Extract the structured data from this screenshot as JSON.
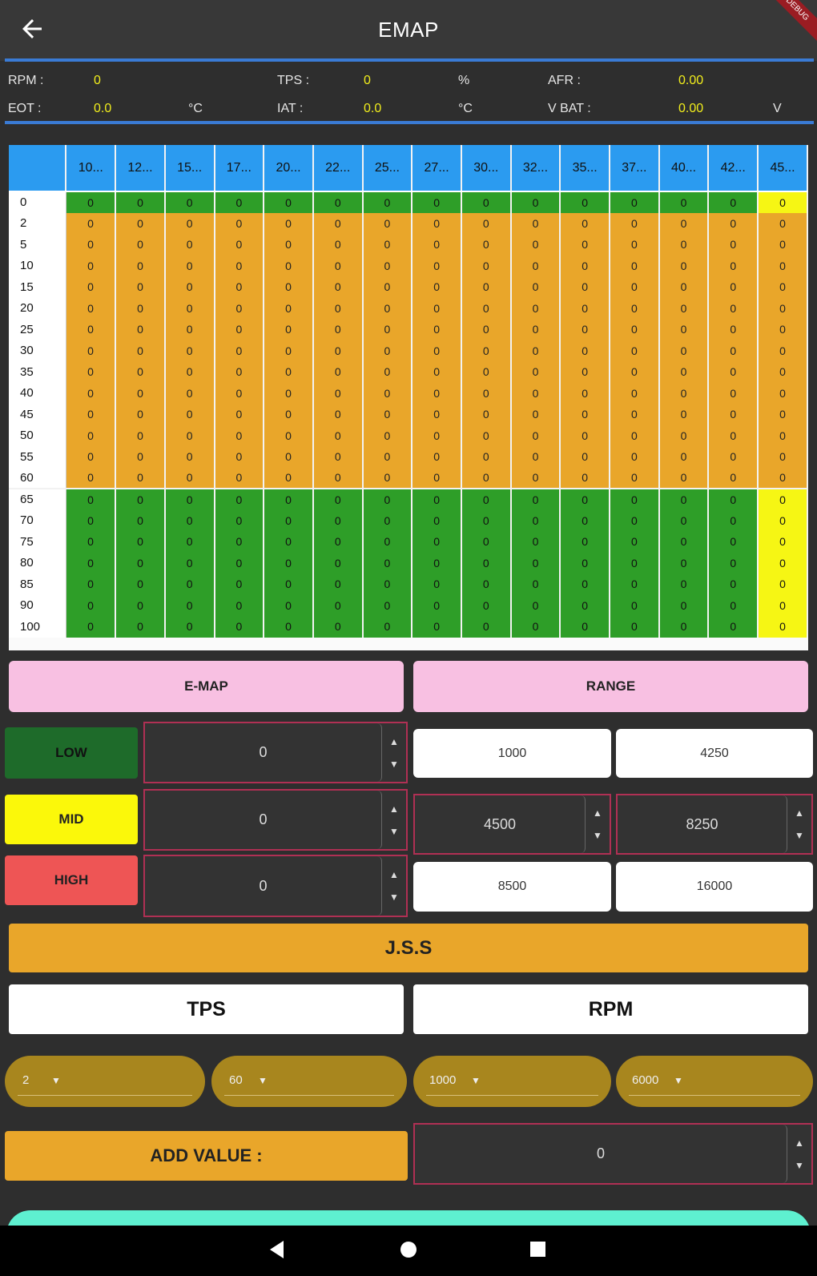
{
  "app": {
    "title": "EMAP",
    "debug_banner": "DEBUG"
  },
  "status": {
    "rpm": {
      "label": "RPM :",
      "value": "0"
    },
    "tps": {
      "label": "TPS :",
      "value": "0",
      "unit": "%"
    },
    "afr": {
      "label": "AFR   :",
      "value": "0.00"
    },
    "eot": {
      "label": "EOT :",
      "value": "0.0",
      "unit": "°C"
    },
    "iat": {
      "label": "IAT :",
      "value": "0.0",
      "unit": "°C"
    },
    "vbat": {
      "label": "V BAT :",
      "value": "0.00",
      "unit": "V"
    }
  },
  "table": {
    "columns": [
      "10...",
      "12...",
      "15...",
      "17...",
      "20...",
      "22...",
      "25...",
      "27...",
      "30...",
      "32...",
      "35...",
      "37...",
      "40...",
      "42...",
      "45..."
    ],
    "rows": [
      "0",
      "2",
      "5",
      "10",
      "15",
      "20",
      "25",
      "30",
      "35",
      "40",
      "45",
      "50",
      "55",
      "60",
      "65",
      "70",
      "75",
      "80",
      "85",
      "90",
      "100"
    ],
    "cell_value": "0",
    "colors": {
      "green": "#2e9e28",
      "orange": "#e9a62a",
      "yellow": "#f6f614",
      "header": "#2b9bf0"
    }
  },
  "buttons": {
    "emap": "E-MAP",
    "range": "RANGE",
    "low": "LOW",
    "mid": "MID",
    "high": "HIGH",
    "jss": "J.S.S",
    "tps": "TPS",
    "rpm": "RPM",
    "add_value": "ADD VALUE :"
  },
  "levels": {
    "low_value": "0",
    "mid_value": "0",
    "high_value": "0",
    "low_range": [
      "1000",
      "4250"
    ],
    "mid_range": [
      "4500",
      "8250"
    ],
    "high_range": [
      "8500",
      "16000"
    ],
    "colors": {
      "low": "#1e6b2a",
      "mid": "#fbf80a",
      "high": "#ee5555"
    }
  },
  "dropdowns": {
    "tps_from": "2",
    "tps_to": "60",
    "rpm_from": "1000",
    "rpm_to": "6000"
  },
  "add_value_input": "0"
}
